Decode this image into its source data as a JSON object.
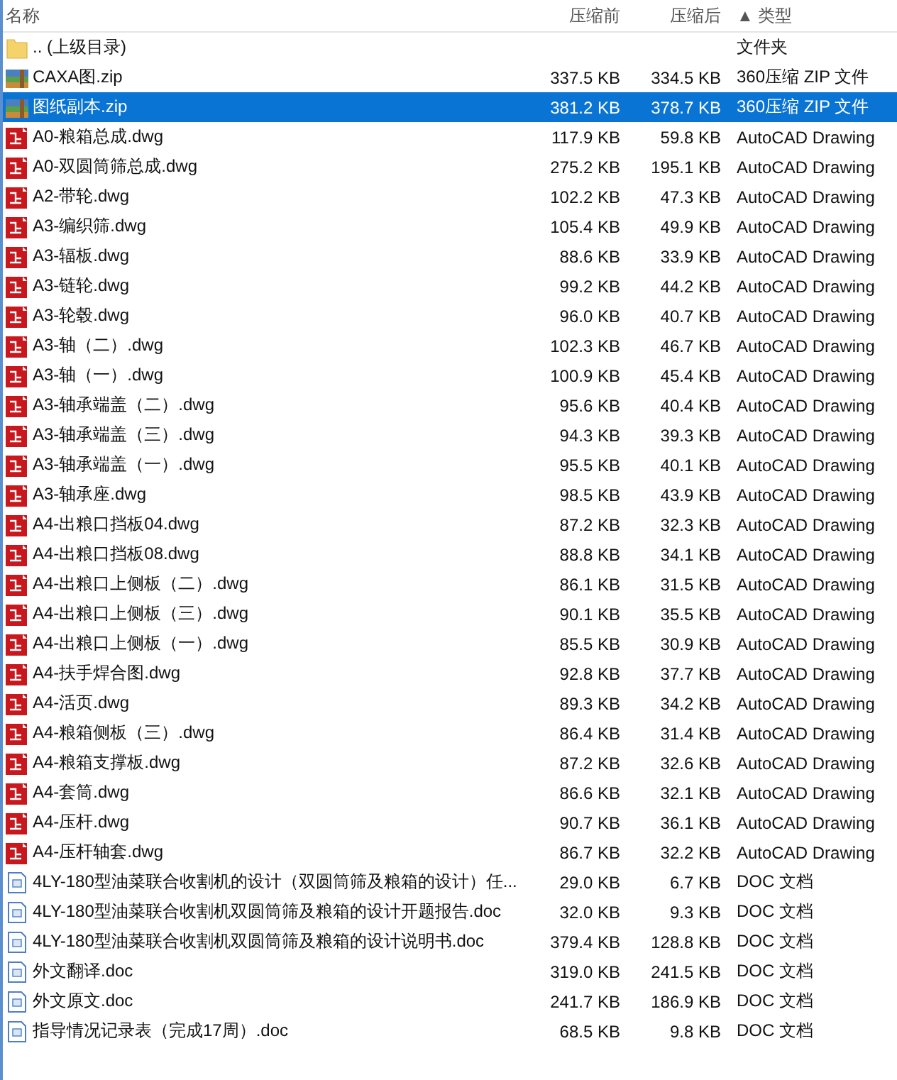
{
  "columns": [
    "名称",
    "压缩前",
    "压缩后",
    "▲ 类型"
  ],
  "rows": [
    {
      "kind": "folder",
      "name": ".. (上级目录)",
      "type": "文件夹",
      "selected": false
    },
    {
      "kind": "zip",
      "name": "CAXA图.zip",
      "size": "337.5 KB",
      "packed": "334.5 KB",
      "type": "360压缩 ZIP 文件",
      "selected": false
    },
    {
      "kind": "zip",
      "name": "图纸副本.zip",
      "size": "381.2 KB",
      "packed": "378.7 KB",
      "type": "360压缩 ZIP 文件",
      "selected": true
    },
    {
      "kind": "dwg",
      "name": "A0-粮箱总成.dwg",
      "size": "117.9 KB",
      "packed": "59.8 KB",
      "type": "AutoCAD Drawing",
      "selected": false
    },
    {
      "kind": "dwg",
      "name": "A0-双圆筒筛总成.dwg",
      "size": "275.2 KB",
      "packed": "195.1 KB",
      "type": "AutoCAD Drawing",
      "selected": false
    },
    {
      "kind": "dwg",
      "name": "A2-带轮.dwg",
      "size": "102.2 KB",
      "packed": "47.3 KB",
      "type": "AutoCAD Drawing",
      "selected": false
    },
    {
      "kind": "dwg",
      "name": "A3-编织筛.dwg",
      "size": "105.4 KB",
      "packed": "49.9 KB",
      "type": "AutoCAD Drawing",
      "selected": false
    },
    {
      "kind": "dwg",
      "name": "A3-辐板.dwg",
      "size": "88.6 KB",
      "packed": "33.9 KB",
      "type": "AutoCAD Drawing",
      "selected": false
    },
    {
      "kind": "dwg",
      "name": "A3-链轮.dwg",
      "size": "99.2 KB",
      "packed": "44.2 KB",
      "type": "AutoCAD Drawing",
      "selected": false
    },
    {
      "kind": "dwg",
      "name": "A3-轮毂.dwg",
      "size": "96.0 KB",
      "packed": "40.7 KB",
      "type": "AutoCAD Drawing",
      "selected": false
    },
    {
      "kind": "dwg",
      "name": "A3-轴（二）.dwg",
      "size": "102.3 KB",
      "packed": "46.7 KB",
      "type": "AutoCAD Drawing",
      "selected": false
    },
    {
      "kind": "dwg",
      "name": "A3-轴（一）.dwg",
      "size": "100.9 KB",
      "packed": "45.4 KB",
      "type": "AutoCAD Drawing",
      "selected": false
    },
    {
      "kind": "dwg",
      "name": "A3-轴承端盖（二）.dwg",
      "size": "95.6 KB",
      "packed": "40.4 KB",
      "type": "AutoCAD Drawing",
      "selected": false
    },
    {
      "kind": "dwg",
      "name": "A3-轴承端盖（三）.dwg",
      "size": "94.3 KB",
      "packed": "39.3 KB",
      "type": "AutoCAD Drawing",
      "selected": false
    },
    {
      "kind": "dwg",
      "name": "A3-轴承端盖（一）.dwg",
      "size": "95.5 KB",
      "packed": "40.1 KB",
      "type": "AutoCAD Drawing",
      "selected": false
    },
    {
      "kind": "dwg",
      "name": "A3-轴承座.dwg",
      "size": "98.5 KB",
      "packed": "43.9 KB",
      "type": "AutoCAD Drawing",
      "selected": false
    },
    {
      "kind": "dwg",
      "name": "A4-出粮口挡板04.dwg",
      "size": "87.2 KB",
      "packed": "32.3 KB",
      "type": "AutoCAD Drawing",
      "selected": false
    },
    {
      "kind": "dwg",
      "name": "A4-出粮口挡板08.dwg",
      "size": "88.8 KB",
      "packed": "34.1 KB",
      "type": "AutoCAD Drawing",
      "selected": false
    },
    {
      "kind": "dwg",
      "name": "A4-出粮口上侧板（二）.dwg",
      "size": "86.1 KB",
      "packed": "31.5 KB",
      "type": "AutoCAD Drawing",
      "selected": false
    },
    {
      "kind": "dwg",
      "name": "A4-出粮口上侧板（三）.dwg",
      "size": "90.1 KB",
      "packed": "35.5 KB",
      "type": "AutoCAD Drawing",
      "selected": false
    },
    {
      "kind": "dwg",
      "name": "A4-出粮口上侧板（一）.dwg",
      "size": "85.5 KB",
      "packed": "30.9 KB",
      "type": "AutoCAD Drawing",
      "selected": false
    },
    {
      "kind": "dwg",
      "name": "A4-扶手焊合图.dwg",
      "size": "92.8 KB",
      "packed": "37.7 KB",
      "type": "AutoCAD Drawing",
      "selected": false
    },
    {
      "kind": "dwg",
      "name": "A4-活页.dwg",
      "size": "89.3 KB",
      "packed": "34.2 KB",
      "type": "AutoCAD Drawing",
      "selected": false
    },
    {
      "kind": "dwg",
      "name": "A4-粮箱侧板（三）.dwg",
      "size": "86.4 KB",
      "packed": "31.4 KB",
      "type": "AutoCAD Drawing",
      "selected": false
    },
    {
      "kind": "dwg",
      "name": "A4-粮箱支撑板.dwg",
      "size": "87.2 KB",
      "packed": "32.6 KB",
      "type": "AutoCAD Drawing",
      "selected": false
    },
    {
      "kind": "dwg",
      "name": "A4-套筒.dwg",
      "size": "86.6 KB",
      "packed": "32.1 KB",
      "type": "AutoCAD Drawing",
      "selected": false
    },
    {
      "kind": "dwg",
      "name": "A4-压杆.dwg",
      "size": "90.7 KB",
      "packed": "36.1 KB",
      "type": "AutoCAD Drawing",
      "selected": false
    },
    {
      "kind": "dwg",
      "name": "A4-压杆轴套.dwg",
      "size": "86.7 KB",
      "packed": "32.2 KB",
      "type": "AutoCAD Drawing",
      "selected": false
    },
    {
      "kind": "doc",
      "name": "4LY-180型油菜联合收割机的设计（双圆筒筛及粮箱的设计）任...",
      "size": "29.0 KB",
      "packed": "6.7 KB",
      "type": "DOC 文档",
      "selected": false
    },
    {
      "kind": "doc",
      "name": "4LY-180型油菜联合收割机双圆筒筛及粮箱的设计开题报告.doc",
      "size": "32.0 KB",
      "packed": "9.3 KB",
      "type": "DOC 文档",
      "selected": false
    },
    {
      "kind": "doc",
      "name": "4LY-180型油菜联合收割机双圆筒筛及粮箱的设计说明书.doc",
      "size": "379.4 KB",
      "packed": "128.8 KB",
      "type": "DOC 文档",
      "selected": false
    },
    {
      "kind": "doc",
      "name": "外文翻译.doc",
      "size": "319.0 KB",
      "packed": "241.5 KB",
      "type": "DOC 文档",
      "selected": false
    },
    {
      "kind": "doc",
      "name": "外文原文.doc",
      "size": "241.7 KB",
      "packed": "186.9 KB",
      "type": "DOC 文档",
      "selected": false
    },
    {
      "kind": "doc",
      "name": "指导情况记录表（完成17周）.doc",
      "size": "68.5 KB",
      "packed": "9.8 KB",
      "type": "DOC 文档",
      "selected": false
    }
  ]
}
